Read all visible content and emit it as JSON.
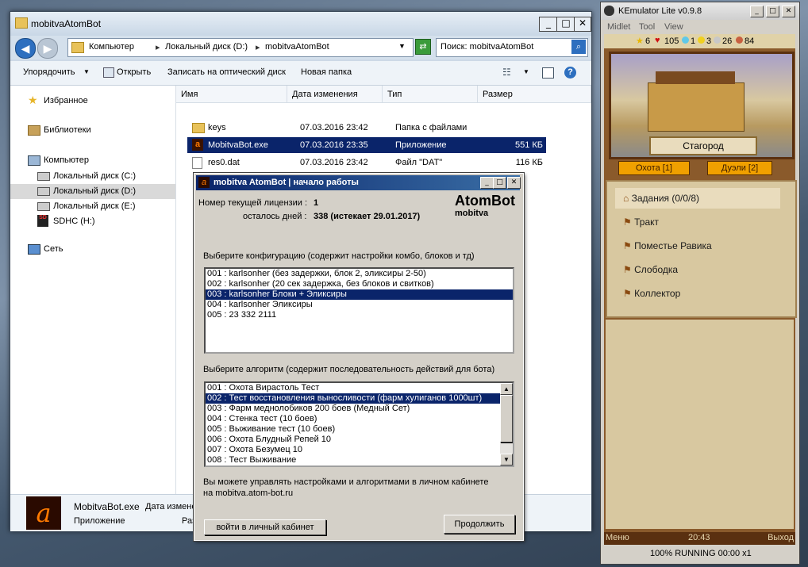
{
  "explorer": {
    "title": "mobitvaAtomBot",
    "breadcrumb": [
      "Компьютер",
      "Локальный диск (D:)",
      "mobitvaAtomBot"
    ],
    "search_placeholder": "Поиск: mobitvaAtomBot",
    "commands": [
      "Упорядочить",
      "Открыть",
      "Записать на оптический диск",
      "Новая папка"
    ],
    "nav": {
      "favorites": "Избранное",
      "libraries": "Библиотеки",
      "computer": "Компьютер",
      "drives": [
        "Локальный диск (C:)",
        "Локальный диск (D:)",
        "Локальный диск (E:)",
        "SDHC (H:)"
      ],
      "network": "Сеть"
    },
    "columns": [
      "Имя",
      "Дата изменения",
      "Тип",
      "Размер"
    ],
    "files": [
      {
        "name": "keys",
        "date": "07.03.2016 23:42",
        "type": "Папка с файлами",
        "size": ""
      },
      {
        "name": "MobitvaBot.exe",
        "date": "07.03.2016 23:35",
        "type": "Приложение",
        "size": "551 КБ"
      },
      {
        "name": "res0.dat",
        "date": "07.03.2016 23:42",
        "type": "Файл \"DAT\"",
        "size": "116 КБ"
      }
    ],
    "details": {
      "name": "MobitvaBot.exe",
      "kind": "Приложение",
      "date_label": "Дата измене",
      "size_label": "Раз"
    }
  },
  "dialog": {
    "title": "mobitva AtomBot | начало работы",
    "license_label": "Номер текущей лицензии :",
    "license_value": "1",
    "days_label": "осталось дней :",
    "days_value": "338 (истекает 29.01.2017)",
    "logo_main": "AtomBot",
    "logo_sub": "mobitva",
    "config_label": "Выберите конфигурацию (содержит настройки комбо, блоков и тд)",
    "configs": [
      "001 : karlsonher (без задержки, блок 2, эликсиры 2-50)",
      "002 : karlsonher (20 сек задержка, без блоков и свитков)",
      "003 : karlsonher Блоки + Эликсиры",
      "004 : karlsonher Эликсиры",
      "005 : 23 332 2111"
    ],
    "config_selected": 2,
    "algo_label": "Выберите алгоритм (содержит последовательность действий для бота)",
    "algos": [
      "001 : Охота Вирастоль Тест",
      "002 : Тест восстановления выносливости (фарм хулиганов 1000шт)",
      "003 : Фарм меднолобиков 200 боев (Медный Сет)",
      "004 : Стенка тест (10 боев)",
      "005 : Выживание тест (10 боев)",
      "006 : Охота Блудный Репей 10",
      "007 : Охота Безумец 10",
      "008 : Тест Выживание"
    ],
    "algo_selected": 1,
    "info_line1": "Вы можете управлять настройками и алгоритмами в личном кабинете",
    "info_line2": "на mobitva.atom-bot.ru",
    "cabinet_button": "войти в личный кабинет",
    "continue_button": "Продолжить"
  },
  "kemulator": {
    "title": "KEmulator Lite v0.9.8",
    "menu": [
      "Midlet",
      "Tool",
      "View"
    ],
    "stats": {
      "stars": "6",
      "hearts": "105",
      "a": "1",
      "b": "3",
      "c": "26",
      "d": "84"
    },
    "location": "Стагород",
    "hunt_button": "Охота [1]",
    "duel_button": "Дуэли [2]",
    "items": [
      "Задания (0/0/8)",
      "Тракт",
      "Поместье Равика",
      "Слободка",
      "Коллектор"
    ],
    "softkey_left": "Меню",
    "clock": "20:43",
    "softkey_right": "Выход",
    "status": "100% RUNNING 00:00 x1"
  }
}
